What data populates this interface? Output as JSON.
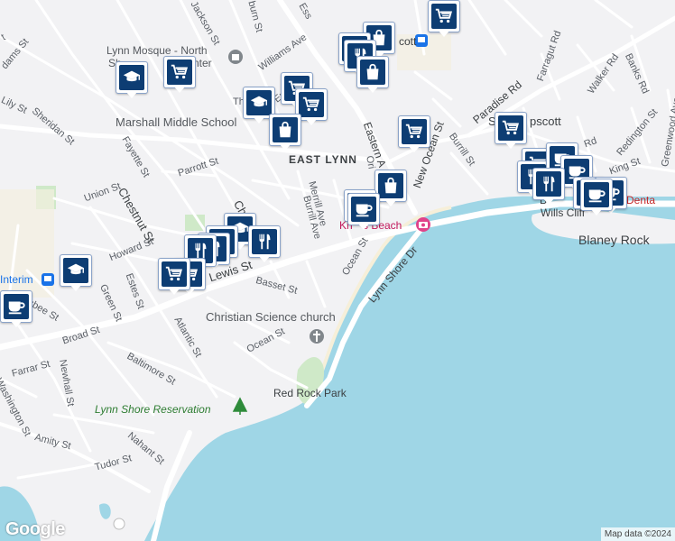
{
  "map": {
    "colors": {
      "water": "#9fd6e6",
      "land": "#f2f2f4",
      "road": "#ffffff",
      "park": "#cfe9c8",
      "marker": "#0d3d73"
    },
    "labels": {
      "east_lynn": "EAST LYNN",
      "lynn_mosque_1": "Lynn Mosque - North",
      "lynn_mosque_2": "Sh",
      "lynn_mosque_3": "nter",
      "marshall": "Marshall Middle School",
      "swampscott": "Swa",
      "swampscott_2": "pscott",
      "kings_beach_1": "Kn",
      "kings_beach_2": "s Beach",
      "christian_science": "Christian Science church",
      "red_rock": "Red Rock Park",
      "lynn_shore": "Lynn Shore Reservation",
      "blaney_rock": "Blaney Rock",
      "wills_cliff": "Wills Cliff",
      "wills_b": "B",
      "denta": "p Denta",
      "interim": "Interim",
      "ott": "cott",
      "streets": {
        "jackson": "Jackson St",
        "ess": "Ess",
        "burn": "burn St",
        "williams": "Williams Ave",
        "adams": "dams St",
        "lily": "Lily St",
        "sheridan": "Sheridan St",
        "fayette": "Fayette St",
        "parrott": "Parrott St",
        "union": "Union St",
        "chestnut": "Chestnut St",
        "howard": "Howard St",
        "lewis": "Lewis St",
        "green": "Green St",
        "estes": "Estes St",
        "basset": "Basset St",
        "broad": "Broad St",
        "atlantic": "Atlantic St",
        "baltimore": "Baltimore St",
        "ocean_sw": "Ocean St",
        "farrar": "Farrar St",
        "newhall": "Newhall St",
        "washington": "Washington St",
        "amity": "Amity St",
        "nahant": "Nahant St",
        "tudor": "Tudor St",
        "ilsbee": "ilsbee St",
        "merrill": "Merrill Ave",
        "burrill_ave": "Burrill Ave",
        "ocean_st": "Ocean St",
        "lynn_shore_dr": "Lynn Shore Dr",
        "eastern_a": "Eastern A",
        "ori": "Ori",
        "new_ocean": "New Ocean St",
        "burrill_st": "Burrill St",
        "paradise": "Paradise Rd",
        "farragut": "Farragut Rd",
        "walker": "Walker Rd",
        "banks": "Banks Rd",
        "redington": "Redington St",
        "greenwood": "Greenwood Ave",
        "king": "King St",
        "rd": "Rd",
        "em": "Em",
        "th": "Th",
        "ch": "Ch"
      }
    },
    "markers": [
      {
        "name": "shopping-cart",
        "icon": "cart"
      },
      {
        "name": "shopping-bag",
        "icon": "bag"
      },
      {
        "name": "school",
        "icon": "school"
      },
      {
        "name": "restaurant",
        "icon": "food"
      },
      {
        "name": "cafe",
        "icon": "coffee"
      }
    ],
    "attribution": "Map data ©2024",
    "logo": "Google"
  }
}
